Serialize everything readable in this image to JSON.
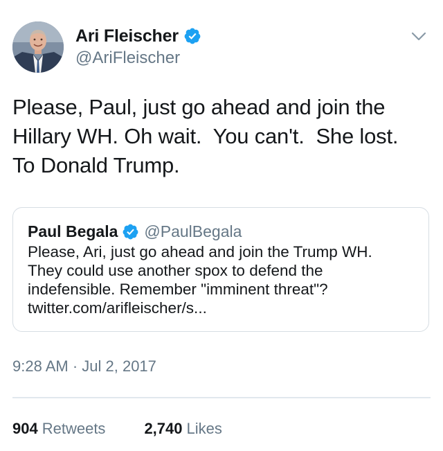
{
  "tweet": {
    "author": {
      "display_name": "Ari Fleischer",
      "handle": "@AriFleischer",
      "verified": true
    },
    "text": "Please, Paul, just go ahead and join the\nHillary WH. Oh wait.  You can't.  She lost.\nTo Donald Trump.",
    "quoted_tweet": {
      "display_name": "Paul Begala",
      "handle": "@PaulBegala",
      "verified": true,
      "text": "Please, Ari, just go ahead and join the Trump WH.\nThey could use another spox to defend the\nindefensible. Remember \"imminent threat\"?\ntwitter.com/arifleischer/s..."
    },
    "timestamp": "9:28 AM · Jul 2, 2017",
    "stats": {
      "retweets_count": "904",
      "retweets_label": "Retweets",
      "likes_count": "2,740",
      "likes_label": "Likes"
    }
  },
  "colors": {
    "verified_blue": "#1da1f2",
    "secondary_text": "#657786",
    "primary_text": "#14171a",
    "border": "#d6dde3"
  },
  "icons": {
    "verified": "verified-badge-icon",
    "caret": "chevron-down-icon"
  }
}
